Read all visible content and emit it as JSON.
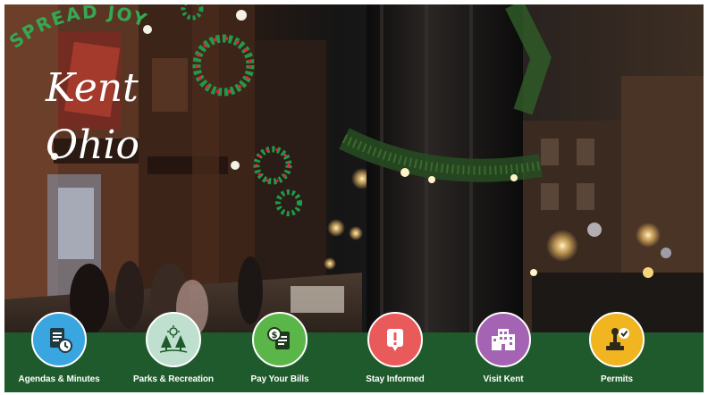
{
  "hero": {
    "tagline": "SPREAD JOY",
    "city": "Kent",
    "state": "Ohio"
  },
  "quick_links": [
    {
      "label": "Agendas & Minutes",
      "icon": "agenda-clock-icon",
      "color": "#3aa6e0"
    },
    {
      "label": "Parks & Recreation",
      "icon": "trees-icon",
      "color": "#bfe0cf"
    },
    {
      "label": "Pay Your Bills",
      "icon": "bill-payment-icon",
      "color": "#5bb64a"
    },
    {
      "label": "Stay Informed",
      "icon": "alert-notice-icon",
      "color": "#e95a5a"
    },
    {
      "label": "Visit Kent",
      "icon": "buildings-icon",
      "color": "#a463b3"
    },
    {
      "label": "Permits",
      "icon": "stamp-approved-icon",
      "color": "#f0b521"
    }
  ],
  "colors": {
    "bar": "#1f5a2c",
    "tagline": "#34a853",
    "script_text": "#ffffff"
  }
}
